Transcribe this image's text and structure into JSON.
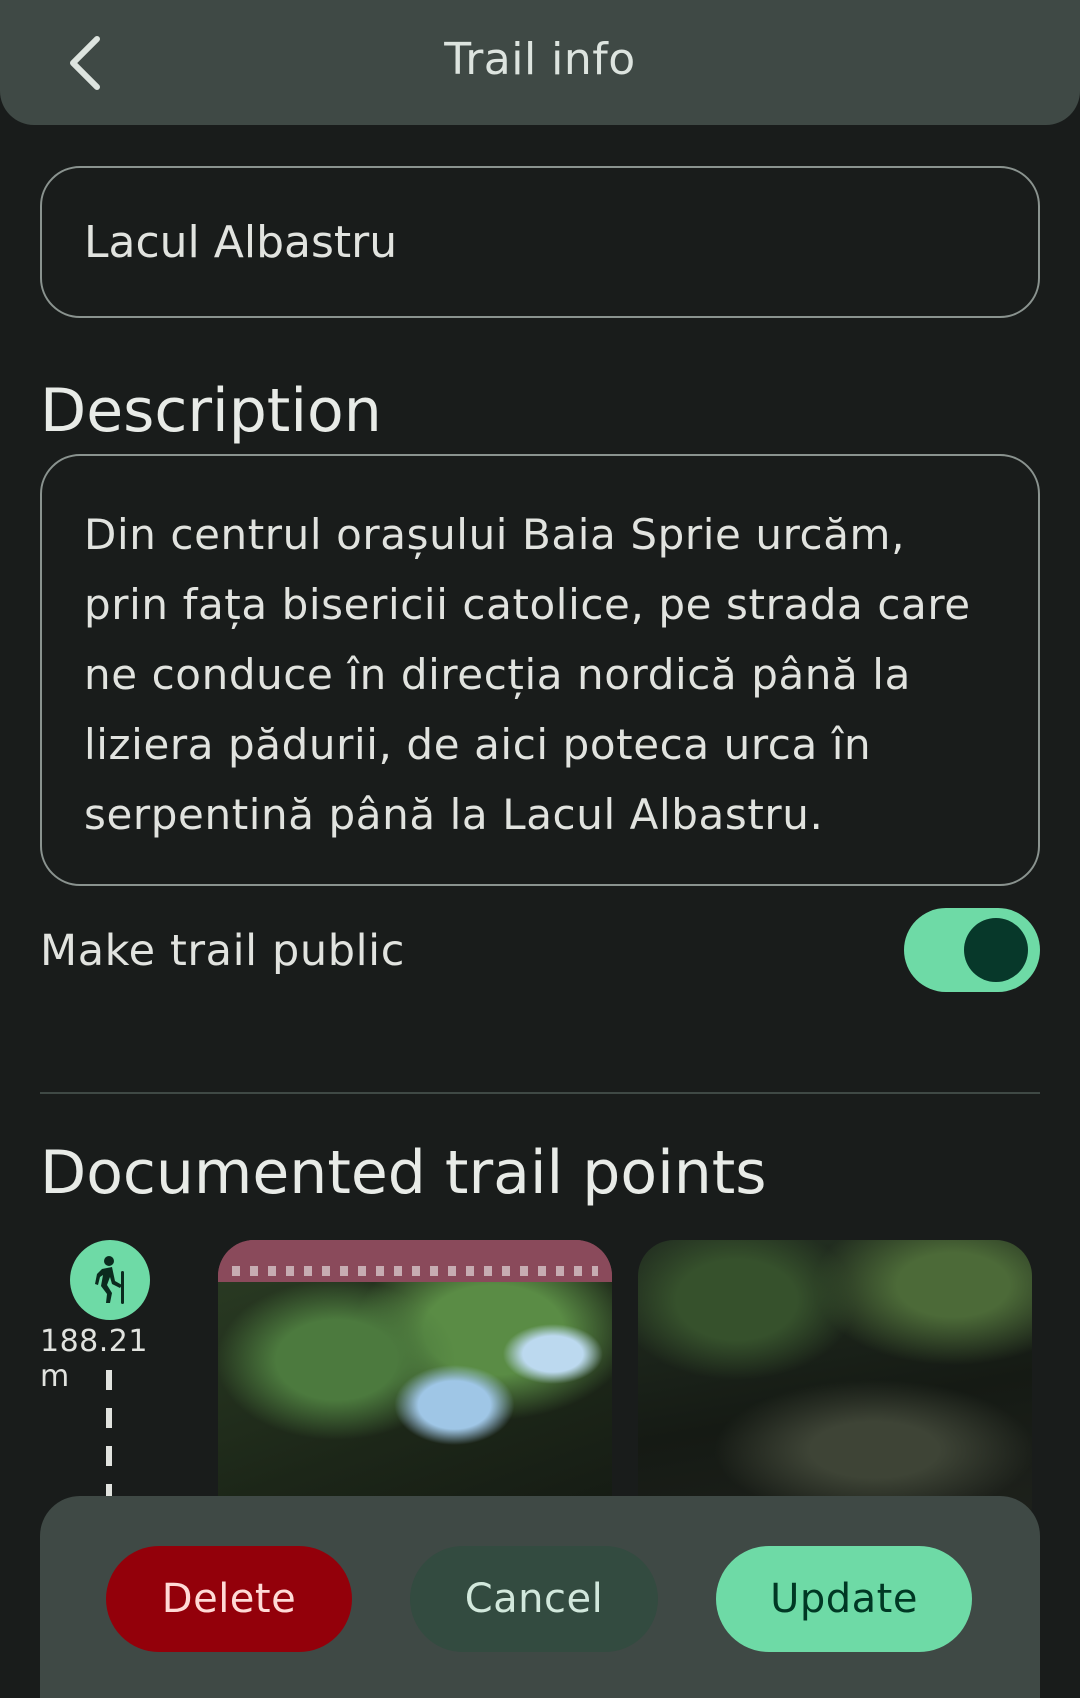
{
  "header": {
    "title": "Trail info",
    "back_icon": "chevron-left-icon"
  },
  "form": {
    "trail_name_value": "Lacul Albastru",
    "description_heading": "Description",
    "description_lines": [
      "Din centrul orașului Baia Sprie urcăm,",
      "prin fața bisericii catolice, pe strada care",
      "ne conduce în direcția nordică până la",
      "liziera pădurii, de aici poteca urca în",
      "serpentină până la Lacul Albastru."
    ],
    "make_public_label": "Make trail public",
    "make_public_enabled": true
  },
  "points": {
    "heading": "Documented trail points",
    "first_point": {
      "icon": "hiker-icon",
      "distance": "188.21 m"
    }
  },
  "actions": {
    "delete_label": "Delete",
    "cancel_label": "Cancel",
    "update_label": "Update"
  },
  "colors": {
    "background": "#191c1b",
    "surface": "#3f4945",
    "accent": "#6edaa6",
    "danger": "#93000a"
  }
}
